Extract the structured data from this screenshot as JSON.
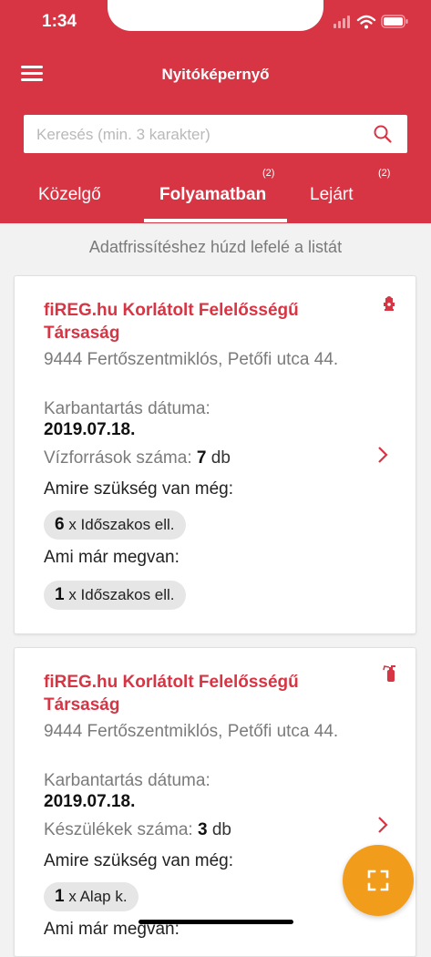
{
  "status_bar": {
    "time": "1:34"
  },
  "header": {
    "title": "Nyitóképernyő"
  },
  "search": {
    "placeholder": "Keresés (min. 3 karakter)"
  },
  "tabs": [
    {
      "label": "Közelgő",
      "count": ""
    },
    {
      "label": "Folyamatban",
      "count": "(2)"
    },
    {
      "label": "Lejárt",
      "count": "(2)"
    }
  ],
  "hint": "Adatfrissítéshez húzd lefelé a listát",
  "cards": [
    {
      "title": "fiREG.hu Korlátolt Felelősségű Társaság",
      "address": "9444 Fertőszentmiklós, Petőfi utca 44.",
      "date_label": "Karbantartás dátuma:",
      "date": "2019.07.18.",
      "count_label": "Vízforrások száma:",
      "count": "7",
      "count_unit": "db",
      "needed_label": "Amire szükség van még:",
      "needed_qty": "6",
      "needed_item": "x Időszakos ell.",
      "have_label": "Ami már megvan:",
      "have_qty": "1",
      "have_item": "x Időszakos ell.",
      "icon": "hydrant-icon"
    },
    {
      "title": "fiREG.hu Korlátolt Felelősségű Társaság",
      "address": "9444 Fertőszentmiklós, Petőfi utca 44.",
      "date_label": "Karbantartás dátuma:",
      "date": "2019.07.18.",
      "count_label": "Készülékek száma:",
      "count": "3",
      "count_unit": "db",
      "needed_label": "Amire szükség van még:",
      "needed_qty": "1",
      "needed_item": "x Alap k.",
      "have_label": "Ami már megvan:",
      "icon": "extinguisher-icon"
    }
  ],
  "colors": {
    "brand": "#d73444",
    "fab": "#f29c1b"
  },
  "fab": {
    "icon": "scan-icon"
  }
}
